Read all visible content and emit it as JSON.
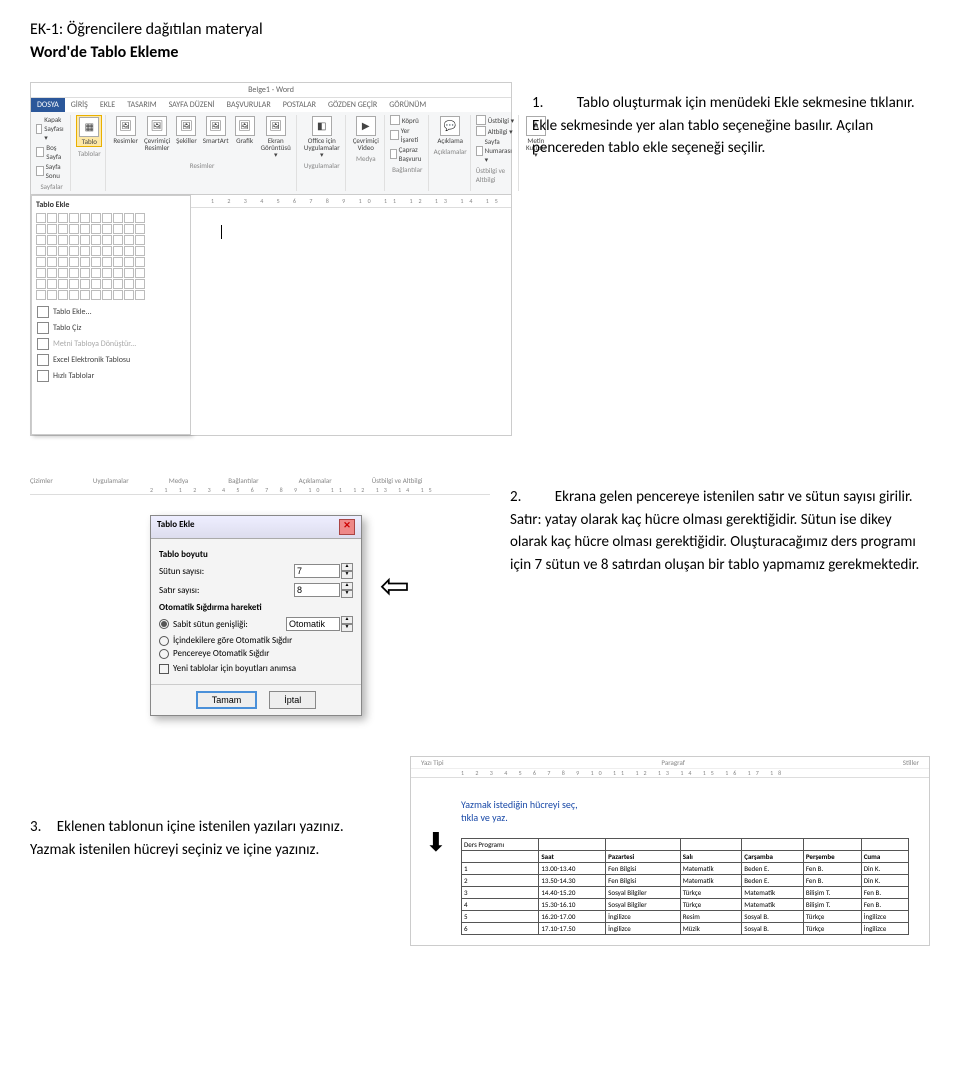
{
  "heading": "EK-1: Öğrencilere dağıtılan materyal",
  "subheading": "Word'de Tablo Ekleme",
  "step1_num": "1.",
  "step1_text": "Tablo oluşturmak için menüdeki Ekle sekmesine tıklanır. Ekle sekmesinde yer alan tablo seçeneğine basılır. Açılan pencereden tablo ekle seçeneği seçilir.",
  "step2_num": "2.",
  "step2_text": "Ekrana gelen pencereye istenilen satır ve sütun sayısı girilir. Satır: yatay olarak kaç hücre olması gerektiğidir. Sütun ise dikey olarak kaç hücre olması gerektiğidir. Oluşturacağımız ders programı için 7 sütun ve 8 satırdan oluşan bir tablo yapmamız gerekmektedir.",
  "step3_num": "3.",
  "step3_text": "Eklenen tablonun içine istenilen yazıları yazınız. Yazmak istenilen hücreyi seçiniz ve içine yazınız.",
  "word": {
    "title": "Belge1 - Word",
    "tabs": [
      "DOSYA",
      "GİRİŞ",
      "EKLE",
      "TASARIM",
      "SAYFA DÜZENİ",
      "BAŞVURULAR",
      "POSTALAR",
      "GÖZDEN GEÇİR",
      "GÖRÜNÜM"
    ],
    "active_tab_index": 0,
    "group_sayfalar": {
      "kapak": "Kapak Sayfası ▾",
      "bos": "Boş Sayfa",
      "sonu": "Sayfa Sonu",
      "label": "Sayfalar"
    },
    "group_tablo": {
      "btn": "Tablo",
      "label": "Tablolar"
    },
    "group_resimler": {
      "items": [
        "Resimler",
        "Çevrimiçi Resimler",
        "Şekiller",
        "SmartArt",
        "Grafik",
        "Ekran Görüntüsü ▾"
      ],
      "label": "Resimler"
    },
    "group_uyg": {
      "items": [
        "Office için Uygulamalar ▾"
      ],
      "label": "Uygulamalar"
    },
    "group_medya": {
      "items": [
        "Çevrimiçi Video"
      ],
      "label": "Medya"
    },
    "group_bag": {
      "items": [
        "Köprü",
        "Yer İşareti",
        "Çapraz Başvuru"
      ],
      "label": "Bağlantılar"
    },
    "group_acik": {
      "btn": "Açıklama",
      "label": "Açıklamalar"
    },
    "group_ust": {
      "items": [
        "Üstbilgi ▾",
        "Altbilgi ▾",
        "Sayfa Numarası ▾"
      ],
      "label": "Üstbilgi ve Altbilgi"
    },
    "group_metin": {
      "btn": "Metin Kutusu ▾"
    },
    "tablo_popup": {
      "title": "Tablo Ekle",
      "menu": [
        {
          "label": "Tablo Ekle...",
          "gray": false
        },
        {
          "label": "Tablo Çiz",
          "gray": false
        },
        {
          "label": "Metni Tabloya Dönüştür...",
          "gray": true
        },
        {
          "label": "Excel Elektronik Tablosu",
          "gray": false
        },
        {
          "label": "Hızlı Tablolar",
          "gray": false
        }
      ]
    },
    "ruler": "1  2  3  4  5  6  7  8  9  10 11 12 13 14 15"
  },
  "shot2": {
    "top_labels": [
      "Çizimler",
      "Uygulamalar",
      "Medya",
      "Bağlantılar",
      "Açıklamalar",
      "Üstbilgi ve Altbilgi"
    ],
    "ruler": "2  1    1  2  3  4  5  6  7  8  9 10 11 12 13 14 15",
    "dialog": {
      "title": "Tablo Ekle",
      "section1": "Tablo boyutu",
      "sutun_label": "Sütun sayısı:",
      "sutun_val": "7",
      "satir_label": "Satır sayısı:",
      "satir_val": "8",
      "section2": "Otomatik Sığdırma hareketi",
      "r1": "Sabit sütun genişliği:",
      "r1_val": "Otomatik",
      "r2": "İçindekilere göre Otomatik Sığdır",
      "r3": "Pencereye Otomatik Sığdır",
      "check": "Yeni tablolar için boyutları anımsa",
      "ok": "Tamam",
      "cancel": "İptal"
    }
  },
  "shot3": {
    "ribbon_labels": [
      "Yazı Tipi",
      "Paragraf",
      "Stiller"
    ],
    "ruler": "1 2 3 4 5 6 7 8 9 10 11 12 13 14 15 16 17 18",
    "callout_l1": "Yazmak istediğin hücreyi seç,",
    "callout_l2": "tıkla ve yaz.",
    "corner": "Ders Programı",
    "headers": [
      "",
      "Saat",
      "Pazartesi",
      "Salı",
      "Çarşamba",
      "Perşembe",
      "Cuma"
    ],
    "rows": [
      [
        "1",
        "13.00-13.40",
        "Fen Bilgisi",
        "Matematik",
        "Beden E.",
        "Fen B.",
        "Din K."
      ],
      [
        "2",
        "13.50-14.30",
        "Fen Bilgisi",
        "Matematik",
        "Beden E.",
        "Fen B.",
        "Din K."
      ],
      [
        "3",
        "14.40-15.20",
        "Sosyal Bilgiler",
        "Türkçe",
        "Matematik",
        "Bilişim T.",
        "Fen B."
      ],
      [
        "4",
        "15.30-16.10",
        "Sosyal Bilgiler",
        "Türkçe",
        "Matematik",
        "Bilişim T.",
        "Fen B."
      ],
      [
        "5",
        "16.20-17.00",
        "İngilizce",
        "Resim",
        "Sosyal B.",
        "Türkçe",
        "İngilizce"
      ],
      [
        "6",
        "17.10-17.50",
        "İngilizce",
        "Müzik",
        "Sosyal B.",
        "Türkçe",
        "İngilizce"
      ]
    ]
  }
}
